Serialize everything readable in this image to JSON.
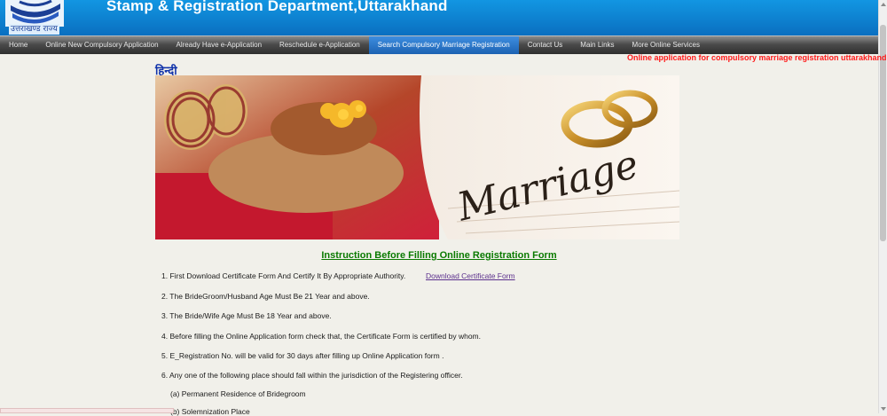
{
  "header": {
    "title": "Stamp & Registration Department,Uttarakhand",
    "logo_text": "उत्तराखण्ड राज्य"
  },
  "nav": [
    {
      "label": "Home",
      "active": false
    },
    {
      "label": "Online New Compulsory Application",
      "active": false
    },
    {
      "label": "Already Have e-Application",
      "active": false
    },
    {
      "label": "Reschedule e-Application",
      "active": false
    },
    {
      "label": "Search Compulsory Marriage Registration",
      "active": true
    },
    {
      "label": "Contact Us",
      "active": false
    },
    {
      "label": "Main Links",
      "active": false
    },
    {
      "label": "More Online Services",
      "active": false
    }
  ],
  "marquee": "Online application for compulsory marriage registration uttarakhand",
  "hindi_link": "हिन्दी",
  "banner": {
    "word": "Marriage"
  },
  "instructions": {
    "title": "Instruction Before Filling Online Registration Form",
    "download_link": "Download Certificate Form",
    "items": [
      "1. First Download Certificate Form And Certify It By Appropriate Authority.",
      "2.  The BrideGroom/Husband Age Must Be 21 Year and above.",
      "3.  The Bride/Wife Age Must Be 18 Year and above.",
      "4.  Before filling the Online Application form check that, the Certificate Form is certified by whom.",
      "5.  E_Registration No. will be valid for 30 days after filling up Online Application form .",
      "6.  Any one of the following place should fall within the jurisdiction of the Registering officer.",
      "(a)   Permanent Residence of Bridegroom",
      "(b)   Solemnization Place"
    ]
  },
  "colors": {
    "header_blue": "#0a7fd4",
    "active_tab": "#2a78d0",
    "title_green": "#0a7a00",
    "marquee_red": "#ff1a1a"
  }
}
